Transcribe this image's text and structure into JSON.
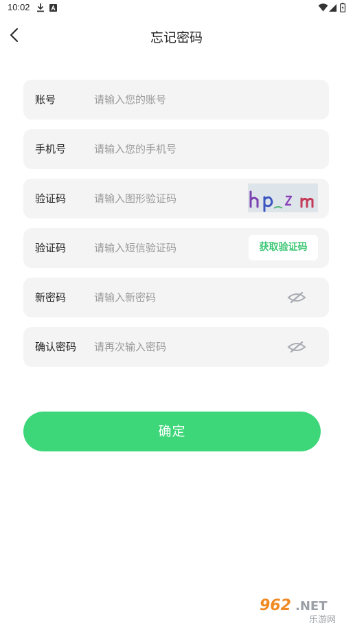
{
  "status_bar": {
    "time": "10:02",
    "icons": [
      "download-icon",
      "notification-a-icon",
      "wifi-icon",
      "signal-icon",
      "battery-icon"
    ]
  },
  "header": {
    "back_icon": "chevron-left-icon",
    "title": "忘记密码"
  },
  "form": {
    "account": {
      "label": "账号",
      "placeholder": "请输入您的账号",
      "value": ""
    },
    "phone": {
      "label": "手机号",
      "placeholder": "请输入您的手机号",
      "value": ""
    },
    "captcha": {
      "label": "验证码",
      "placeholder": "请输入图形验证码",
      "value": "",
      "image_text": "hpzm"
    },
    "sms_code": {
      "label": "验证码",
      "placeholder": "请输入短信验证码",
      "value": "",
      "button_label": "获取验证码"
    },
    "new_password": {
      "label": "新密码",
      "placeholder": "请输入新密码",
      "value": "",
      "toggle_icon": "eye-closed-icon"
    },
    "confirm_password": {
      "label": "确认密码",
      "placeholder": "请再次输入密码",
      "value": "",
      "toggle_icon": "eye-closed-icon"
    }
  },
  "confirm_button": {
    "label": "确定"
  },
  "watermark": {
    "brand": "962.NET",
    "subtitle": "乐游网"
  },
  "colors": {
    "accent": "#3dd77a",
    "accent_text": "#3cc774",
    "field_background": "#f4f4f4",
    "placeholder": "#9a9a9a"
  }
}
